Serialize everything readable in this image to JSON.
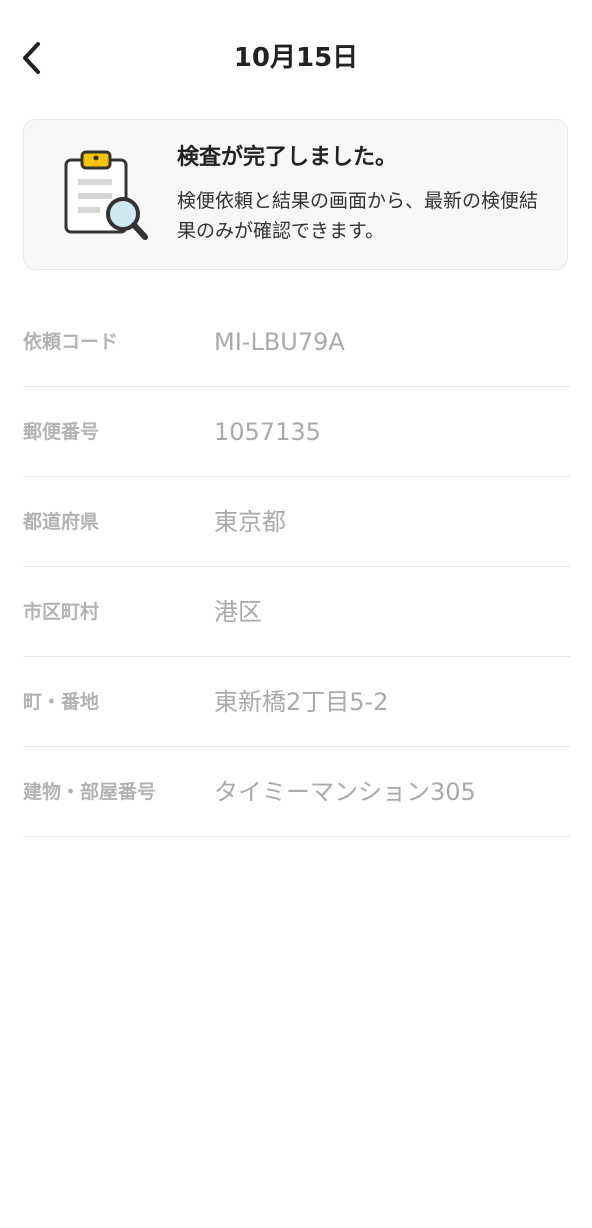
{
  "header": {
    "title": "10月15日",
    "back_icon": "chevron-left-icon"
  },
  "notice": {
    "icon": "clipboard-search-icon",
    "title": "検査が完了しました。",
    "body": "検便依頼と結果の画面から、最新の検便結果のみが確認できます。"
  },
  "fields": [
    {
      "label": "依頼コード",
      "value": "MI-LBU79A"
    },
    {
      "label": "郵便番号",
      "value": "1057135"
    },
    {
      "label": "都道府県",
      "value": "東京都"
    },
    {
      "label": "市区町村",
      "value": "港区"
    },
    {
      "label": "町・番地",
      "value": "東新橋2丁目5-2"
    },
    {
      "label": "建物・部屋番号",
      "value": "タイミーマンション305"
    }
  ],
  "colors": {
    "accent_yellow": "#f5c400",
    "magnifier_fill": "#cfe8f2",
    "label_gray": "#b3b3b3",
    "value_gray": "#aaaaaa"
  }
}
